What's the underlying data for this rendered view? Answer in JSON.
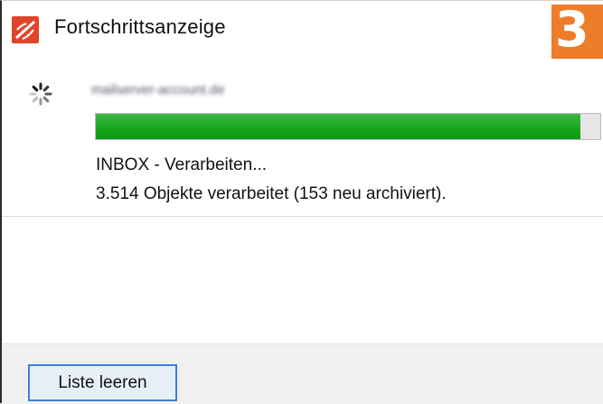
{
  "window": {
    "title": "Fortschrittsanzeige",
    "icon": "app-logo-icon",
    "step_badge": "3"
  },
  "progress": {
    "spinner_icon": "loading-spinner-icon",
    "account": "mailserver-account.de",
    "fraction": 0.96,
    "fill_color": "#17a61e",
    "folder_status": "INBOX - Verarbeiten...",
    "items_status": "3.514 Objekte verarbeitet (153 neu archiviert)."
  },
  "footer": {
    "clear_button_label": "Liste leeren"
  },
  "colors": {
    "badge": "#ee7d2a",
    "button_border": "#3d7fd8",
    "footer_bg": "#f0f0f0"
  }
}
